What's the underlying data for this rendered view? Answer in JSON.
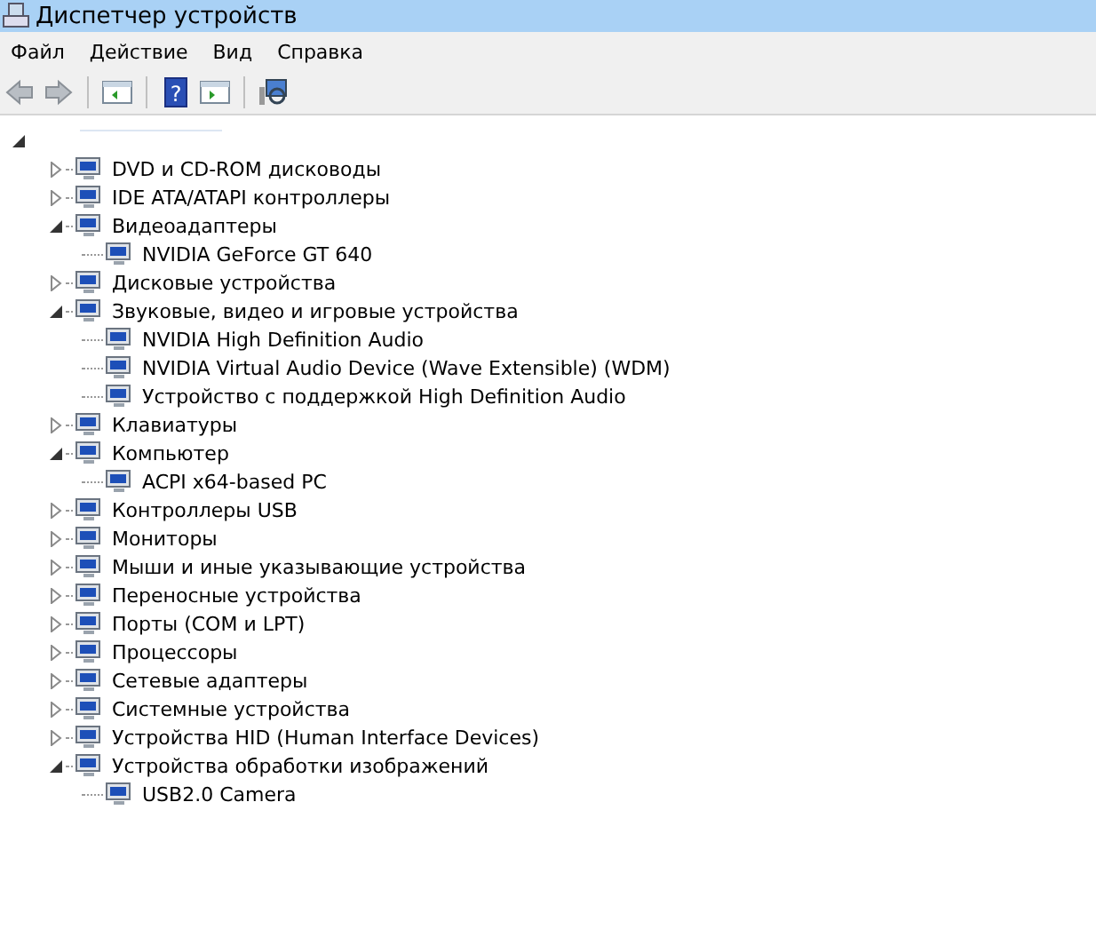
{
  "window": {
    "title": "Диспетчер устройств"
  },
  "menu": [
    "Файл",
    "Действие",
    "Вид",
    "Справка"
  ],
  "toolbar": {
    "help_glyph": "?"
  },
  "tree": {
    "expanded": true,
    "children": [
      {
        "label": "DVD и CD-ROM дисководы",
        "expanded": false
      },
      {
        "label": "IDE ATA/ATAPI контроллеры",
        "expanded": false
      },
      {
        "label": "Видеоадаптеры",
        "expanded": true,
        "children": [
          {
            "label": "NVIDIA GeForce GT 640"
          }
        ]
      },
      {
        "label": "Дисковые устройства",
        "expanded": false
      },
      {
        "label": "Звуковые, видео и игровые устройства",
        "expanded": true,
        "children": [
          {
            "label": "NVIDIA High Definition Audio"
          },
          {
            "label": "NVIDIA Virtual Audio Device (Wave Extensible) (WDM)"
          },
          {
            "label": "Устройство с поддержкой High Definition Audio"
          }
        ]
      },
      {
        "label": "Клавиатуры",
        "expanded": false
      },
      {
        "label": "Компьютер",
        "expanded": true,
        "children": [
          {
            "label": "ACPI x64-based PC"
          }
        ]
      },
      {
        "label": "Контроллеры USB",
        "expanded": false
      },
      {
        "label": "Мониторы",
        "expanded": false
      },
      {
        "label": "Мыши и иные указывающие устройства",
        "expanded": false
      },
      {
        "label": "Переносные устройства",
        "expanded": false
      },
      {
        "label": "Порты (COM и LPT)",
        "expanded": false
      },
      {
        "label": "Процессоры",
        "expanded": false
      },
      {
        "label": "Сетевые адаптеры",
        "expanded": false
      },
      {
        "label": "Системные устройства",
        "expanded": false
      },
      {
        "label": "Устройства HID (Human Interface Devices)",
        "expanded": false
      },
      {
        "label": "Устройства обработки изображений",
        "expanded": true,
        "children": [
          {
            "label": "USB2.0 Camera"
          }
        ]
      }
    ]
  }
}
